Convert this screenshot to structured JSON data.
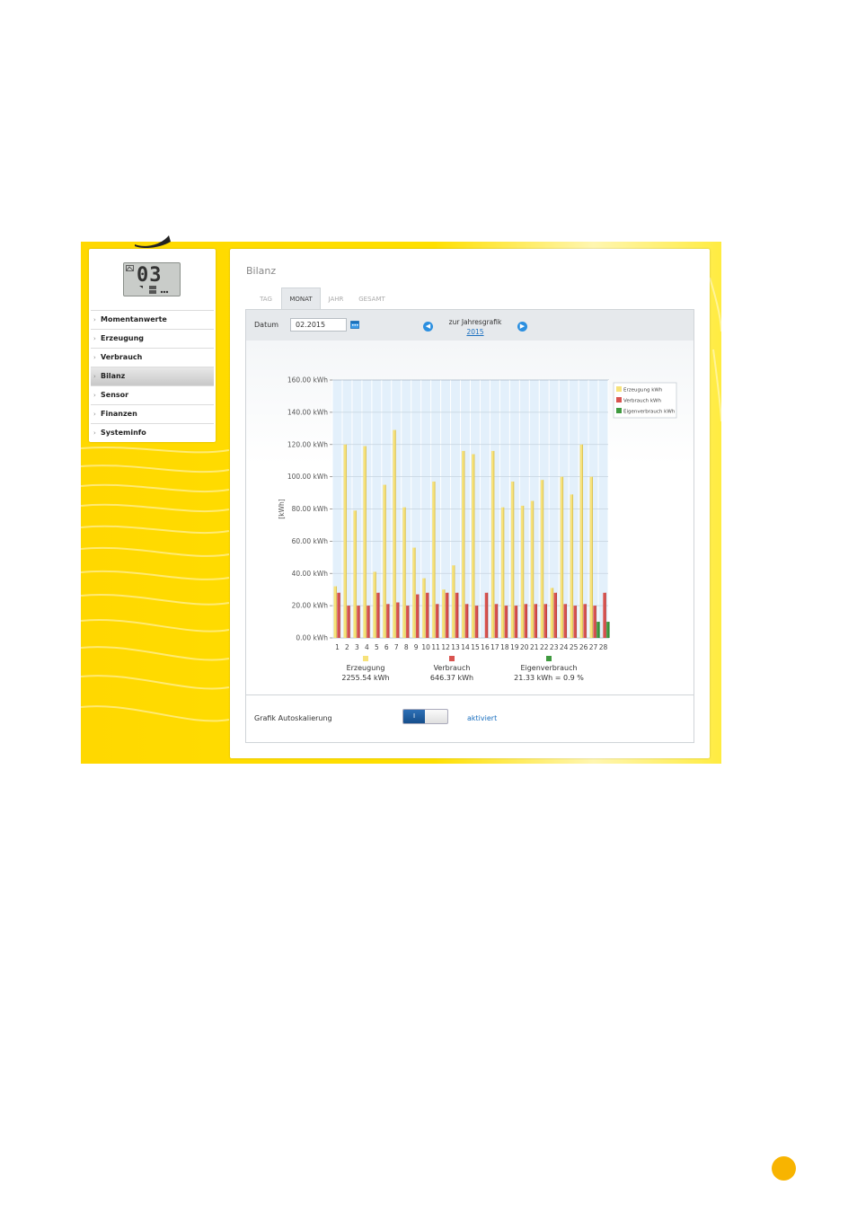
{
  "lcd": {
    "digits": "03"
  },
  "sidebar": {
    "items": [
      {
        "label": "Momentanwerte",
        "active": false
      },
      {
        "label": "Erzeugung",
        "active": false
      },
      {
        "label": "Verbrauch",
        "active": false
      },
      {
        "label": "Bilanz",
        "active": true
      },
      {
        "label": "Sensor",
        "active": false
      },
      {
        "label": "Finanzen",
        "active": false
      },
      {
        "label": "Systeminfo",
        "active": false
      }
    ]
  },
  "main": {
    "title": "Bilanz",
    "tabs": [
      {
        "label": "TAG",
        "active": false
      },
      {
        "label": "MONAT",
        "active": true
      },
      {
        "label": "JAHR",
        "active": false
      },
      {
        "label": "GESAMT",
        "active": false
      }
    ],
    "toolbar": {
      "datum_label": "Datum",
      "datum_value": "02.2015",
      "jahr_label": "zur Jahresgrafik",
      "jahr_link": "2015"
    },
    "summary": [
      {
        "name": "Erzeugung",
        "value": "2255.54 kWh"
      },
      {
        "name": "Verbrauch",
        "value": "646.37 kWh"
      },
      {
        "name": "Eigenverbrauch",
        "value": "21.33 kWh = 0.9 %"
      }
    ],
    "autoscale": {
      "label": "Grafik Autoskalierung",
      "toggle_text": "I",
      "status": "aktiviert"
    }
  },
  "colors": {
    "erzeugung": "#f7e27a",
    "verbrauch": "#d9534f",
    "eigenverbrauch": "#3f9a3f",
    "brand_yellow": "#ffd800",
    "page_dot": "#f8b400"
  },
  "chart_data": {
    "type": "bar",
    "categories": [
      "1",
      "2",
      "3",
      "4",
      "5",
      "6",
      "7",
      "8",
      "9",
      "10",
      "11",
      "12",
      "13",
      "14",
      "15",
      "16",
      "17",
      "18",
      "19",
      "20",
      "21",
      "22",
      "23",
      "24",
      "25",
      "26",
      "27",
      "28"
    ],
    "series": [
      {
        "name": "Erzeugung kWh",
        "values": [
          32,
          120,
          79,
          119,
          41,
          95,
          129,
          81,
          56,
          37,
          97,
          30,
          45,
          116,
          114,
          0,
          116,
          81,
          97,
          82,
          85,
          98,
          31,
          100,
          89,
          120,
          100,
          0
        ]
      },
      {
        "name": "Verbrauch kWh",
        "values": [
          28,
          20,
          20,
          20,
          28,
          21,
          22,
          20,
          27,
          28,
          21,
          28,
          28,
          21,
          20,
          28,
          21,
          20,
          20,
          21,
          21,
          21,
          28,
          21,
          20,
          21,
          20,
          28
        ]
      },
      {
        "name": "Eigenverbrauch kWh",
        "values": [
          0,
          0,
          0,
          0,
          0,
          0,
          0,
          0,
          0,
          0,
          0,
          0,
          0,
          0,
          0,
          0,
          0,
          0,
          0,
          0,
          0,
          0,
          0,
          0,
          0,
          0,
          10,
          10
        ]
      }
    ],
    "ylim": [
      0,
      160
    ],
    "yticks": [
      "0.00 kWh",
      "20.00 kWh",
      "40.00 kWh",
      "60.00 kWh",
      "80.00 kWh",
      "100.00 kWh",
      "120.00 kWh",
      "140.00 kWh",
      "160.00 kWh"
    ],
    "ylabel": "[kWh]",
    "grid": true,
    "legend": "top-right"
  }
}
